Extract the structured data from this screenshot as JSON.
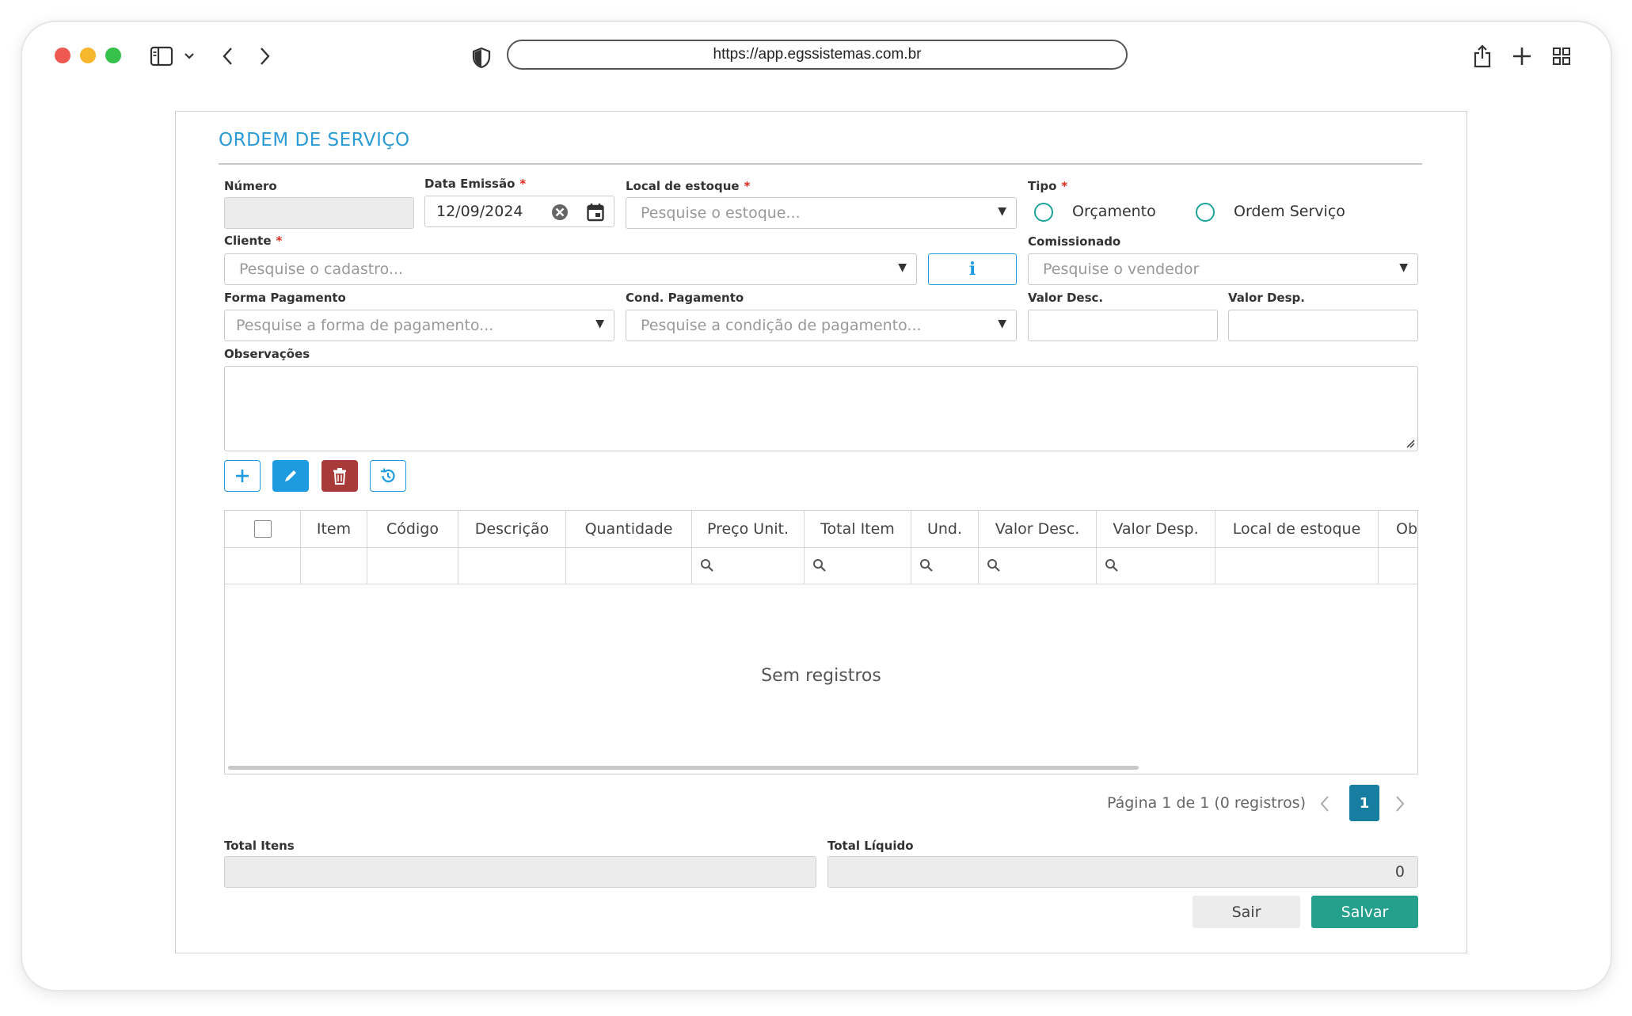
{
  "browser": {
    "url": "https://app.egssistemas.com.br",
    "traffic_lights": [
      "#ee5a52",
      "#f6b62d",
      "#35c14a"
    ]
  },
  "form": {
    "title": "ORDEM DE SERVIÇO",
    "labels": {
      "numero": "Número",
      "data_emissao": "Data Emissão",
      "local_estoque": "Local de estoque",
      "tipo": "Tipo",
      "cliente": "Cliente",
      "comissionado": "Comissionado",
      "forma_pagamento": "Forma Pagamento",
      "cond_pagamento": "Cond. Pagamento",
      "valor_desc": "Valor Desc.",
      "valor_desp": "Valor Desp.",
      "observacoes": "Observações",
      "total_itens": "Total Itens",
      "total_liquido": "Total Líquido"
    },
    "required_mark": "*",
    "values": {
      "numero": "",
      "data_emissao": "12/09/2024",
      "total_itens": "",
      "total_liquido": "0"
    },
    "placeholders": {
      "local_estoque": "Pesquise o estoque...",
      "cliente": "Pesquise o cadastro...",
      "comissionado": "Pesquise o vendedor",
      "forma_pagamento": "Pesquise a forma de pagamento...",
      "cond_pagamento": "Pesquise a condição de pagamento..."
    },
    "tipo_options": [
      "Orçamento",
      "Ordem Serviço"
    ],
    "info_button_glyph": "i"
  },
  "grid": {
    "columns": [
      "Item",
      "Código",
      "Descrição",
      "Quantidade",
      "Preço Unit.",
      "Total Item",
      "Und.",
      "Valor Desc.",
      "Valor Desp.",
      "Local de estoque",
      "Ob"
    ],
    "filterable_columns": [
      "Preço Unit.",
      "Total Item",
      "Und.",
      "Valor Desc.",
      "Valor Desp."
    ],
    "empty_message": "Sem registros"
  },
  "pager": {
    "text": "Página 1 de 1 (0 registros)",
    "current_page": "1"
  },
  "actions": {
    "sair": "Sair",
    "salvar": "Salvar"
  },
  "colors": {
    "accent_blue": "#2b9ad6",
    "edit_button": "#1e9be0",
    "delete_button": "#a83a3a",
    "radio_teal": "#1ea39a",
    "pager_active": "#187ea1",
    "save_button": "#25a08c"
  }
}
